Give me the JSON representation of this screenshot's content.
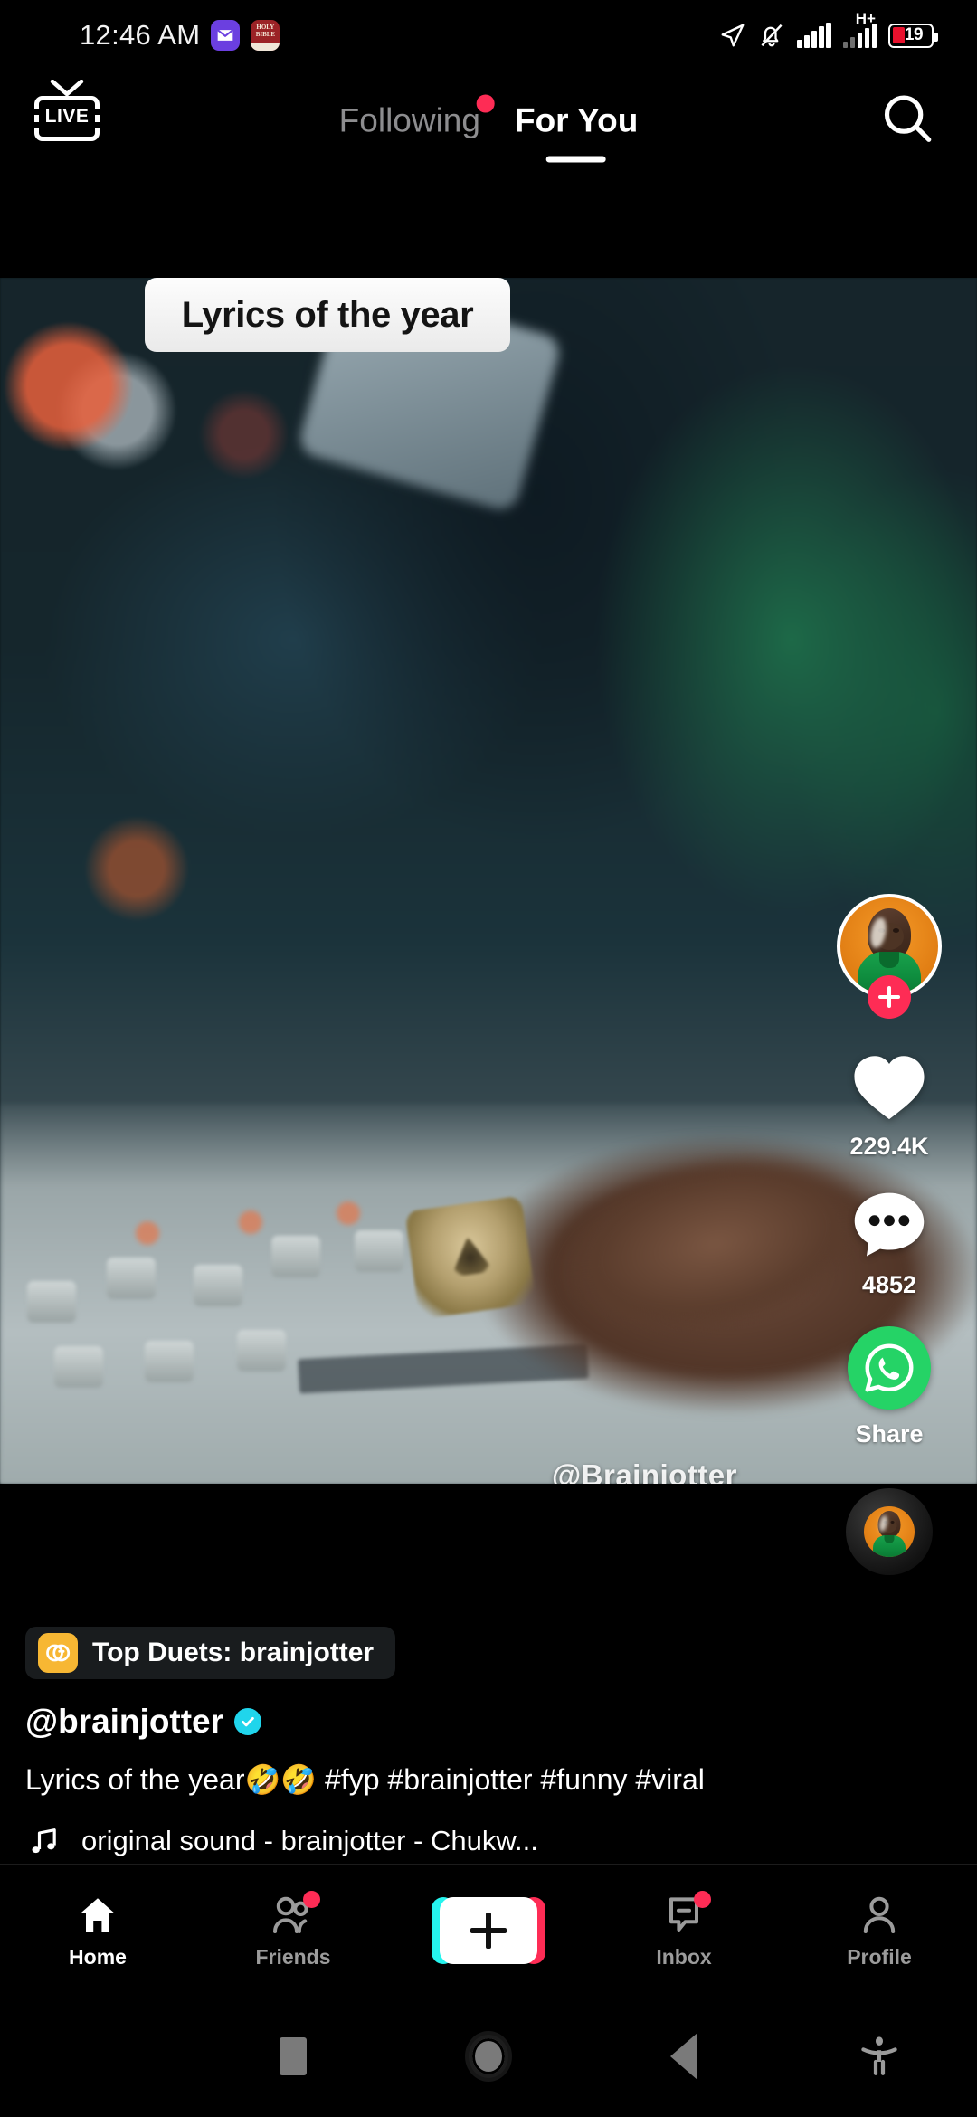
{
  "status_bar": {
    "time": "12:46 AM",
    "left_icons": [
      "mail-icon",
      "bible-app-icon"
    ],
    "right_icons": [
      "location-arrow-icon",
      "notifications-muted-icon",
      "signal-bars-icon",
      "signal-bars-2-icon"
    ],
    "network_type": "H+",
    "battery_percent": "19"
  },
  "top_bar": {
    "live_label": "LIVE",
    "tabs": [
      {
        "label": "Following",
        "active": false,
        "badge": true
      },
      {
        "label": "For You",
        "active": true,
        "badge": false
      }
    ],
    "search_icon": "search-icon"
  },
  "video": {
    "sticker_text": "Lyrics of the year",
    "watermark": "@Brainjotter"
  },
  "actions": {
    "avatar_alt": "brainjotter-avatar",
    "follow_label": "+",
    "like_count": "229.4K",
    "comment_count": "4852",
    "share_label": "Share",
    "share_app": "whatsapp-icon",
    "music_disc": "music-disc"
  },
  "post": {
    "duet_badge": "Top Duets: brainjotter",
    "username": "@brainjotter",
    "verified": true,
    "caption": "Lyrics of the year🤣🤣  #fyp  #brainjotter  #funny  #viral",
    "music": "original sound - brainjotter - Chukw..."
  },
  "bottom_nav": [
    {
      "label": "Home",
      "icon": "home-icon",
      "active": true,
      "badge": false
    },
    {
      "label": "Friends",
      "icon": "friends-icon",
      "active": false,
      "badge": true
    },
    {
      "label": "Inbox",
      "icon": "inbox-icon",
      "active": false,
      "badge": true
    },
    {
      "label": "Profile",
      "icon": "profile-icon",
      "active": false,
      "badge": false
    }
  ],
  "create_button": {
    "label": "+"
  },
  "system_nav": [
    "recents-square-icon",
    "home-circle-icon",
    "back-triangle-icon",
    "accessibility-icon"
  ],
  "colors": {
    "accent_pink": "#FE2C55",
    "accent_cyan": "#25F4EE",
    "verified_blue": "#20D5EC",
    "whatsapp_green": "#25D366",
    "duet_yellow": "#F7B733"
  }
}
